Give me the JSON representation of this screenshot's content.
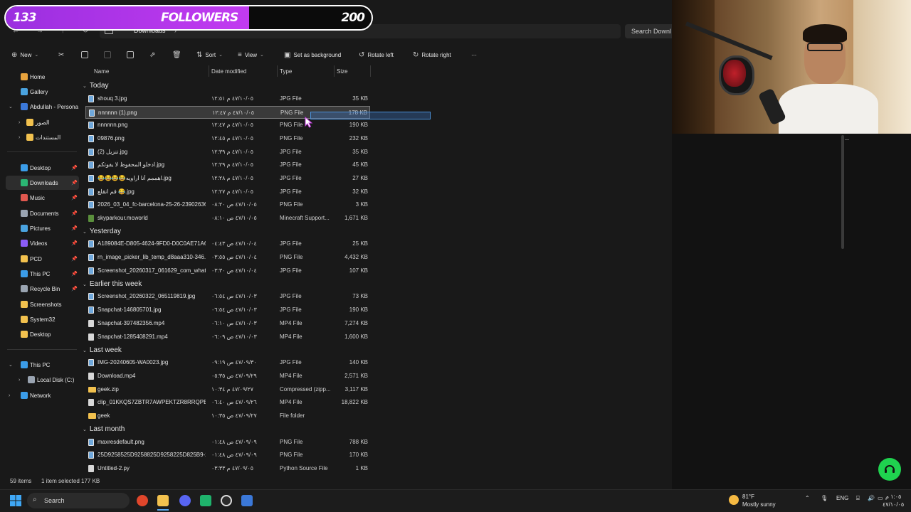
{
  "overlay": {
    "left_count": "133",
    "label": "FOLLOWERS",
    "right_count": "200",
    "progress_fraction": 0.665
  },
  "address": {
    "crumb": "Downloads",
    "search_placeholder": "Search Downl"
  },
  "toolbar": {
    "new_label": "New",
    "sort_label": "Sort",
    "view_label": "View",
    "set_background_label": "Set as background",
    "rotate_left_label": "Rotate left",
    "rotate_right_label": "Rotate right",
    "more_label": "···"
  },
  "sidebar": {
    "items": [
      {
        "label": "Home",
        "color": "#e8a33d"
      },
      {
        "label": "Gallery",
        "color": "#4aa3df"
      },
      {
        "label": "Abdullah - Persona",
        "color": "#3b78d8"
      },
      {
        "label": "الصور",
        "color": "#f2c14e"
      },
      {
        "label": "المستندات",
        "color": "#f2c14e"
      },
      {
        "label": "Desktop",
        "color": "#3b9ce8"
      },
      {
        "label": "Downloads",
        "color": "#2bb673"
      },
      {
        "label": "Music",
        "color": "#e0584f"
      },
      {
        "label": "Documents",
        "color": "#9aa4b1"
      },
      {
        "label": "Pictures",
        "color": "#4aa3df"
      },
      {
        "label": "Videos",
        "color": "#8b5cf6"
      },
      {
        "label": "PCD",
        "color": "#f2c14e"
      },
      {
        "label": "This PC",
        "color": "#3b9ce8"
      },
      {
        "label": "Recycle Bin",
        "color": "#9aa4b1"
      },
      {
        "label": "Screenshots",
        "color": "#f2c14e"
      },
      {
        "label": "System32",
        "color": "#f2c14e"
      },
      {
        "label": "Desktop",
        "color": "#f2c14e"
      },
      {
        "label": "This PC",
        "color": "#3b9ce8"
      },
      {
        "label": "Local Disk (C:)",
        "color": "#9aa4b1"
      },
      {
        "label": "Network",
        "color": "#3b9ce8"
      }
    ]
  },
  "columns": {
    "name": "Name",
    "date": "Date modified",
    "type": "Type",
    "size": "Size"
  },
  "groups": [
    "Today",
    "Yesterday",
    "Earlier this week",
    "Last week",
    "Last month"
  ],
  "files": [
    {
      "name": "shouq 3.jpg",
      "date": "٤٧/١٠/٠٥ م ١٢:٥١",
      "type": "JPG File",
      "size": "35 KB",
      "icon": "img"
    },
    {
      "name": "nnnnnn (1).png",
      "date": "٤٧/١٠/٠٥ م ١٢:٤٧",
      "type": "PNG File",
      "size": "178 KB",
      "icon": "img"
    },
    {
      "name": "nnnnnn.png",
      "date": "٤٧/١٠/٠٥ م ١٢:٤٧",
      "type": "PNG File",
      "size": "190 KB",
      "icon": "img"
    },
    {
      "name": "09876.png",
      "date": "٤٧/١٠/٠٥ م ١٢:٤٥",
      "type": "PNG File",
      "size": "232 KB",
      "icon": "img"
    },
    {
      "name": "تنزيل (2).jpg",
      "date": "٤٧/١٠/٠٥ م ١٢:٣٩",
      "type": "JPG File",
      "size": "35 KB",
      "icon": "img"
    },
    {
      "name": "ادخلو المحفوظ لا يفوتكم.jpg",
      "date": "٤٧/١٠/٠٥ م ١٢:٢٩",
      "type": "JPG File",
      "size": "45 KB",
      "icon": "img"
    },
    {
      "name": "😂😂😂😂اهممم أنا آراويه.jpg",
      "date": "٤٧/١٠/٠٥ م ١٢:٢٨",
      "type": "JPG File",
      "size": "27 KB",
      "icon": "img"
    },
    {
      "name": "قم انقلع 😂.jpg",
      "date": "٤٧/١٠/٠٥ م ١٢:٢٧",
      "type": "JPG File",
      "size": "32 KB",
      "icon": "img"
    },
    {
      "name": "2026_03_04_fc-barcelona-25-26-23902636...",
      "date": "٤٧/١٠/٠٥ ص ٠٨:٢٠",
      "type": "PNG File",
      "size": "3 KB",
      "icon": "img"
    },
    {
      "name": "skyparkour.mcworld",
      "date": "٤٧/١٠/٠٥ ص ٠٨:١٠",
      "type": "Minecraft Support...",
      "size": "1,671 KB",
      "icon": "mc"
    },
    {
      "name": "A189084E-D805-4624-9FD0-D0C0AE71A6...",
      "date": "٤٧/١٠/٠٤ ص ٠٤:٤٣",
      "type": "JPG File",
      "size": "25 KB",
      "icon": "img"
    },
    {
      "name": "rn_image_picker_lib_temp_d8aaa310-346...",
      "date": "٤٧/١٠/٠٤ ص ٠٣:٥٥",
      "type": "PNG File",
      "size": "4,432 KB",
      "icon": "img"
    },
    {
      "name": "Screenshot_20260317_061629_com_whats...",
      "date": "٤٧/١٠/٠٤ ص ٠٣:٣٠",
      "type": "JPG File",
      "size": "107 KB",
      "icon": "img"
    },
    {
      "name": "Screenshot_20260322_065119819.jpg",
      "date": "٤٧/١٠/٠٣ ص ٠٦:٥٤",
      "type": "JPG File",
      "size": "73 KB",
      "icon": "img"
    },
    {
      "name": "Snapchat-146805701.jpg",
      "date": "٤٧/١٠/٠٣ ص ٠٦:٥٤",
      "type": "JPG File",
      "size": "190 KB",
      "icon": "img"
    },
    {
      "name": "Snapchat-397482356.mp4",
      "date": "٤٧/١٠/٠٣ ص ٠٦:١٠",
      "type": "MP4 File",
      "size": "7,274 KB",
      "icon": "vid"
    },
    {
      "name": "Snapchat-1285408291.mp4",
      "date": "٤٧/١٠/٠٣ ص ٠٦:٠٩",
      "type": "MP4 File",
      "size": "1,600 KB",
      "icon": "vid"
    },
    {
      "name": "IMG-20240605-WA0023.jpg",
      "date": "٤٧/٠٩/٣٠ ص ٠٩:١٩",
      "type": "JPG File",
      "size": "140 KB",
      "icon": "img"
    },
    {
      "name": "Download.mp4",
      "date": "٤٧/٠٩/٢٩ ص ٠٥:٣٥",
      "type": "MP4 File",
      "size": "2,571 KB",
      "icon": "vid"
    },
    {
      "name": "geek.zip",
      "date": "٤٧/٠٩/٢٧ م ١٠:٣٤",
      "type": "Compressed (zipp...",
      "size": "3,117 KB",
      "icon": "folder"
    },
    {
      "name": "clip_01KKQS7ZBTR7AWPEKTZR8RRQPE...",
      "date": "٤٧/٠٩/٢٦ ص ٠٦:٤٠",
      "type": "MP4 File",
      "size": "18,822 KB",
      "icon": "vid"
    },
    {
      "name": "geek",
      "date": "٤٧/٠٩/٢٧ ص ١٠:٣٥",
      "type": "File folder",
      "size": "",
      "icon": "folder"
    },
    {
      "name": "maxresdefault.png",
      "date": "٤٧/٠٩/٠٩ ص ٠١:٤٨",
      "type": "PNG File",
      "size": "788 KB",
      "icon": "img"
    },
    {
      "name": "25D9258525D9258825D9258225D825B9-2...",
      "date": "٤٧/٠٩/٠٩ ص ٠١:٤٨",
      "type": "PNG File",
      "size": "170 KB",
      "icon": "img"
    },
    {
      "name": "Untitled-2.py",
      "date": "٤٧/٠٩/٠٥ م ٠٣:٣٣",
      "type": "Python Source File",
      "size": "1 KB",
      "icon": "vid"
    }
  ],
  "status": {
    "count": "59 items",
    "selected": "1 item selected  177 KB"
  },
  "taskbar": {
    "search_label": "Search",
    "weather_temp": "81°F",
    "weather_desc": "Mostly sunny",
    "lang": "ENG",
    "time": "١:٠٥ م",
    "date": "٤٧/١٠/٠٥"
  }
}
